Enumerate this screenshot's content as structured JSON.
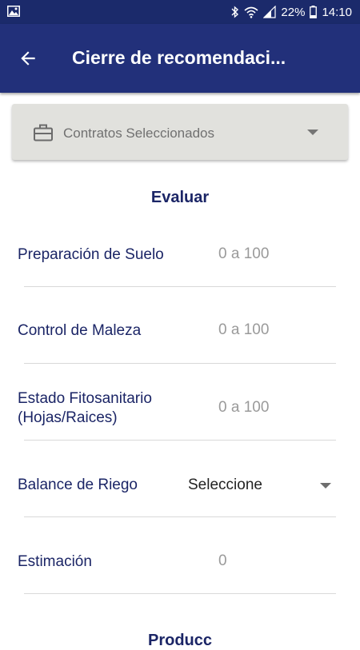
{
  "status_bar": {
    "battery": "22%",
    "time": "14:10"
  },
  "app_bar": {
    "title": "Cierre de recomendaci..."
  },
  "contract_select": {
    "label": "Contratos Seleccionados"
  },
  "section": {
    "title": "Evaluar",
    "next_title_partial": "Producc"
  },
  "fields": {
    "soil_prep": {
      "label": "Preparación de Suelo",
      "placeholder": "0 a 100"
    },
    "weed_control": {
      "label": "Control de Maleza",
      "placeholder": "0 a 100"
    },
    "phyto_state": {
      "label_line1": "Estado Fitosanitario",
      "label_line2": "(Hojas/Raices)",
      "placeholder": "0 a 100"
    },
    "irrigation": {
      "label": "Balance de Riego",
      "selected": "Seleccione"
    },
    "estimate": {
      "label": "Estimación",
      "value": "0"
    }
  }
}
